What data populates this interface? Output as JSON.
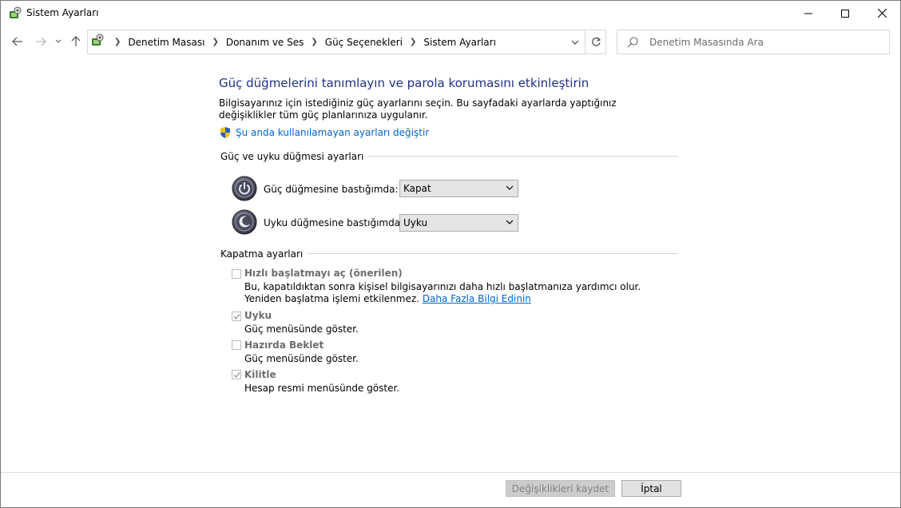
{
  "window": {
    "title": "Sistem Ayarları"
  },
  "breadcrumbs": [
    "Denetim Masası",
    "Donanım ve Ses",
    "Güç Seçenekleri",
    "Sistem Ayarları"
  ],
  "search": {
    "placeholder": "Denetim Masasında Ara"
  },
  "page": {
    "heading": "Güç düğmelerini tanımlayın ve parola korumasını etkinleştirin",
    "description": "Bilgisayarınız için istediğiniz güç ayarlarını seçin. Bu sayfadaki ayarlarda yaptığınız değişiklikler tüm güç planlarınıza uygulanır.",
    "admin_link": "Şu anda kullanılamayan ayarları değiştir"
  },
  "power_group": {
    "label": "Güç ve uyku düğmesi ayarları",
    "power_button": {
      "label": "Güç düğmesine bastığımda:",
      "value": "Kapat"
    },
    "sleep_button": {
      "label": "Uyku düğmesine bastığımda:",
      "value": "Uyku"
    }
  },
  "shutdown_group": {
    "label": "Kapatma ayarları",
    "fast_startup": {
      "title": "Hızlı başlatmayı aç (önerilen)",
      "checked": false,
      "desc_text": "Bu, kapatıldıktan sonra kişisel bilgisayarınızı daha hızlı başlatmanıza yardımcı olur. Yeniden başlatma işlemi etkilenmez.",
      "more_link": "Daha Fazla Bilgi Edinin"
    },
    "sleep": {
      "title": "Uyku",
      "checked": true,
      "desc": "Güç menüsünde göster."
    },
    "hibernate": {
      "title": "Hazırda Beklet",
      "checked": false,
      "desc": "Güç menüsünde göster."
    },
    "lock": {
      "title": "Kilitle",
      "checked": true,
      "desc": "Hesap resmi menüsünde göster."
    }
  },
  "buttons": {
    "save": "Değişiklikleri kaydet",
    "cancel": "İptal"
  }
}
